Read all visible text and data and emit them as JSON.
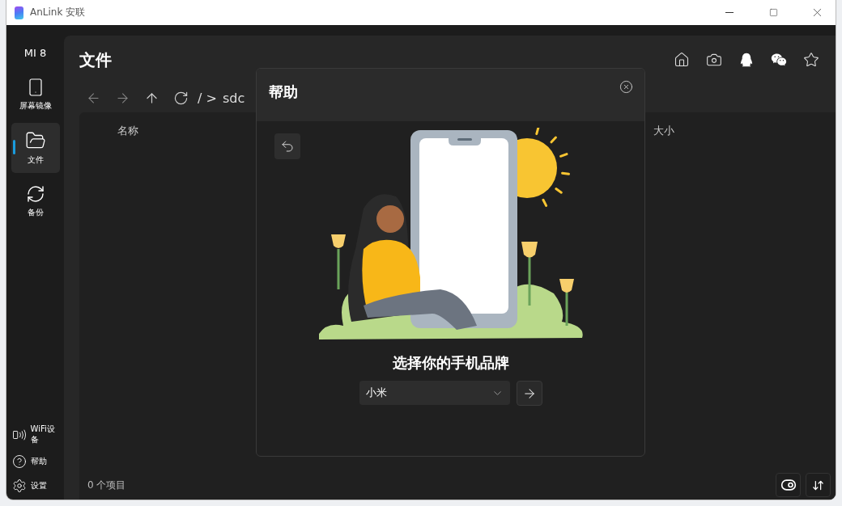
{
  "window": {
    "title": "AnLink 安联"
  },
  "device": {
    "name": "MI 8"
  },
  "sidebar": {
    "items": [
      {
        "kind": "mirror",
        "label": "屏幕镜像",
        "selected": false
      },
      {
        "kind": "files",
        "label": "文件",
        "selected": true
      },
      {
        "kind": "backup",
        "label": "备份",
        "selected": false
      }
    ],
    "bottom_items": [
      {
        "kind": "wifi",
        "label": "WiFi设备"
      },
      {
        "kind": "help",
        "label": "帮助"
      },
      {
        "kind": "settings",
        "label": "设置"
      }
    ]
  },
  "page": {
    "title": "文件",
    "path_separator": "/ >",
    "path": "sdc"
  },
  "table": {
    "columns": [
      "名称",
      "大小"
    ]
  },
  "status": "0 个项目",
  "dialog": {
    "title": "帮助",
    "heading": "选择你的手机品牌",
    "brand_select": {
      "value": "小米"
    }
  }
}
